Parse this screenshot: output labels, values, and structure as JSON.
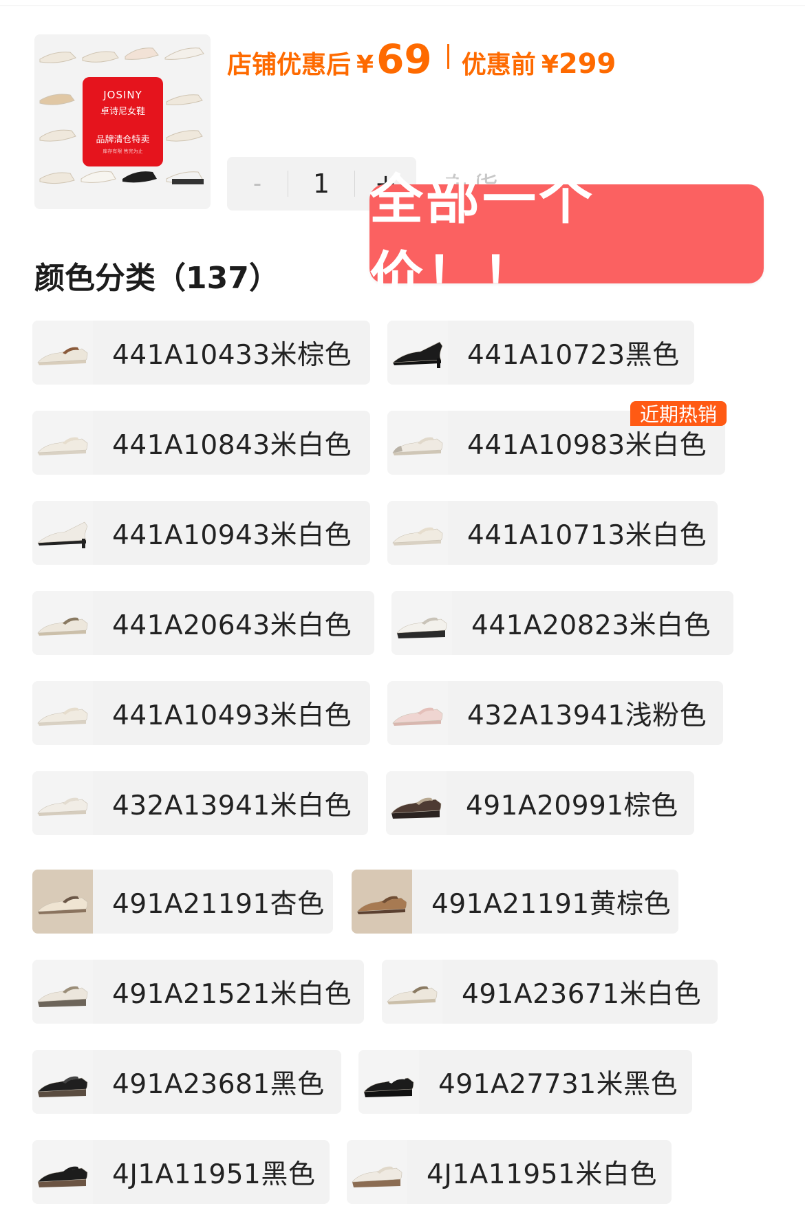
{
  "brand_card": {
    "name": "JOSINY",
    "subtitle": "卓诗尼女鞋",
    "tagline": "品牌清仓特卖",
    "small": "库存有限 售完为止"
  },
  "price": {
    "after_label": "店铺优惠后",
    "after_currency": "¥",
    "after_value": "69",
    "before_label": "优惠前",
    "before_currency": "¥",
    "before_value": "299",
    "color": "#fe6a00"
  },
  "quantity": {
    "minus": "-",
    "value": "1",
    "plus": "+"
  },
  "stock_text": "有货",
  "promo_banner": "全部一个价！！",
  "section_title": "颜色分类（137）",
  "hot_badge": "近期热销",
  "variants": [
    {
      "label": "441A10433米棕色",
      "icon": "shoe-flat-strap-beige"
    },
    {
      "label": "441A10723黑色",
      "icon": "shoe-pump-black"
    },
    {
      "label": "441A10843米白色",
      "icon": "shoe-flat-strap-white"
    },
    {
      "label": "441A10983米白色",
      "icon": "shoe-flat-metal-toe"
    },
    {
      "label": "441A10943米白色",
      "icon": "shoe-pump-white"
    },
    {
      "label": "441A10713米白色",
      "icon": "shoe-flat-strap-white"
    },
    {
      "label": "441A20643米白色",
      "icon": "shoe-loafer-white"
    },
    {
      "label": "441A20823米白色",
      "icon": "shoe-platform-white"
    },
    {
      "label": "441A10493米白色",
      "icon": "shoe-flat-strap-white"
    },
    {
      "label": "432A13941浅粉色",
      "icon": "shoe-flat-pink"
    },
    {
      "label": "432A13941米白色",
      "icon": "shoe-flat-lace-white"
    },
    {
      "label": "491A20991棕色",
      "icon": "shoe-loafer-brown"
    },
    {
      "label": "491A21191杏色",
      "icon": "photo-shoe-apricot"
    },
    {
      "label": "491A21191黄棕色",
      "icon": "photo-shoe-tan"
    },
    {
      "label": "491A21521米白色",
      "icon": "shoe-loafer-heel-white"
    },
    {
      "label": "491A23671米白色",
      "icon": "shoe-loafer-white"
    },
    {
      "label": "491A23681黑色",
      "icon": "shoe-oxford-black"
    },
    {
      "label": "491A27731米黑色",
      "icon": "shoe-oxford-black-white"
    },
    {
      "label": "4J1A11951黑色",
      "icon": "shoe-maryjane-black"
    },
    {
      "label": "4J1A11951米白色",
      "icon": "shoe-maryjane-white"
    }
  ]
}
